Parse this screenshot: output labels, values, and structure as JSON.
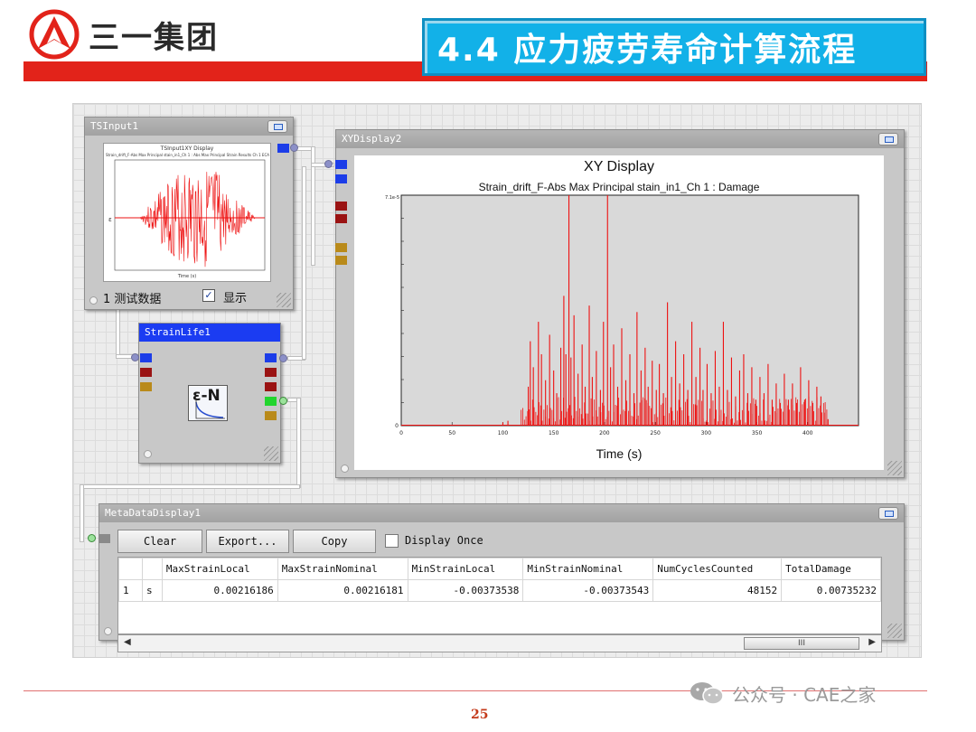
{
  "header": {
    "company": "三一集团",
    "section_title": "4.4 应力疲劳寿命计算流程",
    "brand_red": "#e2231a",
    "title_blue": "#12b1e8"
  },
  "ts_input": {
    "title": "TSInput1",
    "plot_title": "TSInput1XY Display",
    "plot_subtitle": "Strain_drift_F-Abs Max Principal stain_in1_Ch 1 : Abs Max Principal Strain Results Ch 1 ECA",
    "x_label": "Time (s)",
    "channel_label": "1 测试数据",
    "show_label": "显示",
    "show_checked": true,
    "check_mark": "✓"
  },
  "strain_life": {
    "title": "StrainLife1",
    "icon_text": "ε-N",
    "icon_name": "strain-life-icon"
  },
  "xy_display": {
    "title": "XYDisplay2"
  },
  "chart_data": {
    "type": "line",
    "title": "XY Display",
    "subtitle": "Strain_drift_F-Abs Max Principal stain_in1_Ch 1 : Damage",
    "xlabel": "Time (s)",
    "ylabel": "",
    "xlim": [
      0,
      450
    ],
    "ylim": [
      0,
      7.1e-05
    ],
    "x_ticks": [
      "0",
      "50",
      "100",
      "150",
      "200",
      "250",
      "300",
      "350",
      "400"
    ],
    "y_top_label": "7.1e-5",
    "y_zero_label": "0",
    "series_color": "#ee1111",
    "grid": false,
    "peaks": [
      [
        100,
        1e-06
      ],
      [
        105,
        1.5e-06
      ],
      [
        125,
        1.2e-05
      ],
      [
        127,
        2.6e-05
      ],
      [
        130,
        1.8e-05
      ],
      [
        135,
        3.2e-05
      ],
      [
        138,
        2.2e-05
      ],
      [
        142,
        1.4e-05
      ],
      [
        146,
        2.8e-05
      ],
      [
        150,
        1.7e-05
      ],
      [
        153,
        1e-05
      ],
      [
        157,
        2.4e-05
      ],
      [
        160,
        4e-05
      ],
      [
        162,
        2.2e-05
      ],
      [
        165,
        7.1e-05
      ],
      [
        167,
        2.1e-05
      ],
      [
        170,
        3.4e-05
      ],
      [
        174,
        1.6e-05
      ],
      [
        178,
        2.5e-05
      ],
      [
        181,
        1.2e-05
      ],
      [
        185,
        3.7e-05
      ],
      [
        188,
        1.5e-05
      ],
      [
        192,
        2.3e-05
      ],
      [
        196,
        1.1e-05
      ],
      [
        199,
        3.2e-05
      ],
      [
        203,
        7.1e-05
      ],
      [
        206,
        1.8e-05
      ],
      [
        209,
        2.5e-05
      ],
      [
        213,
        1.2e-05
      ],
      [
        217,
        3e-05
      ],
      [
        221,
        1.4e-05
      ],
      [
        225,
        2.2e-05
      ],
      [
        229,
        1e-05
      ],
      [
        232,
        3.5e-05
      ],
      [
        236,
        1.7e-05
      ],
      [
        240,
        2.4e-05
      ],
      [
        243,
        1.2e-05
      ],
      [
        247,
        2e-05
      ],
      [
        251,
        1.1e-05
      ],
      [
        254,
        1.9e-05
      ],
      [
        258,
        1e-05
      ],
      [
        262,
        3.8e-05
      ],
      [
        266,
        1.5e-05
      ],
      [
        270,
        2.6e-05
      ],
      [
        274,
        1.3e-05
      ],
      [
        278,
        2.2e-05
      ],
      [
        282,
        1.1e-05
      ],
      [
        286,
        3.2e-05
      ],
      [
        290,
        1.5e-05
      ],
      [
        294,
        2.4e-05
      ],
      [
        297,
        1.1e-05
      ],
      [
        301,
        1.9e-05
      ],
      [
        305,
        1e-05
      ],
      [
        309,
        2.3e-05
      ],
      [
        313,
        1.2e-05
      ],
      [
        317,
        3.2e-05
      ],
      [
        321,
        1.1e-05
      ],
      [
        325,
        2.1e-05
      ],
      [
        329,
        9e-06
      ],
      [
        333,
        1.7e-05
      ],
      [
        337,
        2.2e-05
      ],
      [
        341,
        1e-05
      ],
      [
        345,
        1.8e-05
      ],
      [
        349,
        8e-06
      ],
      [
        353,
        1.5e-05
      ],
      [
        357,
        1e-05
      ],
      [
        361,
        1.9e-05
      ],
      [
        365,
        8e-06
      ],
      [
        369,
        1.3e-05
      ],
      [
        373,
        7e-06
      ],
      [
        377,
        1.6e-05
      ],
      [
        381,
        8e-06
      ],
      [
        385,
        1.3e-05
      ],
      [
        389,
        7e-06
      ],
      [
        393,
        1.8e-05
      ],
      [
        397,
        8e-06
      ],
      [
        401,
        1.4e-05
      ],
      [
        405,
        7e-06
      ],
      [
        409,
        1.2e-05
      ],
      [
        413,
        9e-06
      ],
      [
        417,
        4e-06
      ],
      [
        420,
        2e-06
      ]
    ]
  },
  "metadata": {
    "title": "MetaDataDisplay1",
    "buttons": {
      "clear": "Clear",
      "export": "Export...",
      "copy": "Copy"
    },
    "display_once_label": "Display Once",
    "display_once_checked": false,
    "columns": [
      "MaxStrainLocal",
      "MaxStrainNominal",
      "MinStrainLocal",
      "MinStrainNominal",
      "NumCyclesCounted",
      "TotalDamage"
    ],
    "row": {
      "index": "1",
      "unit": "s",
      "values": [
        "0.00216186",
        "0.00216181",
        "-0.00373538",
        "-0.00373543",
        "48152",
        "0.00735232"
      ]
    },
    "scroll_thumb": "III",
    "scroll_left": "◀",
    "scroll_right": "▶"
  },
  "footer": {
    "page_number": "25",
    "watermark": "公众号 · CAE之家"
  }
}
